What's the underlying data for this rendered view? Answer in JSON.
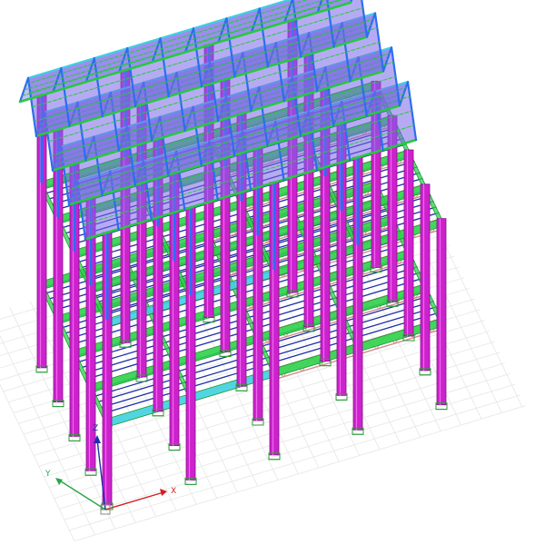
{
  "axis_triad": {
    "x_label": "X",
    "y_label": "Y",
    "z_label": "Z"
  },
  "colors": {
    "column": "#cc22cc",
    "column_dark": "#8a0f8a",
    "column_hi": "#ee66ee",
    "floor_beam": "#2fd24b",
    "floor_beam_dark": "#1c9a33",
    "secondary_beam": "#1d2fa8",
    "light_beam": "#3fd0e0",
    "roof_rafter": "#2d6df0",
    "roof_panel": "#7a66e8",
    "roof_edge": "#26c93e",
    "truss": "#d38b8b",
    "grid": "#e6e6e6",
    "support": "#2e9e3a",
    "axis_x": "#d42020",
    "axis_y": "#2aa64a",
    "axis_z": "#1f2fb0"
  }
}
